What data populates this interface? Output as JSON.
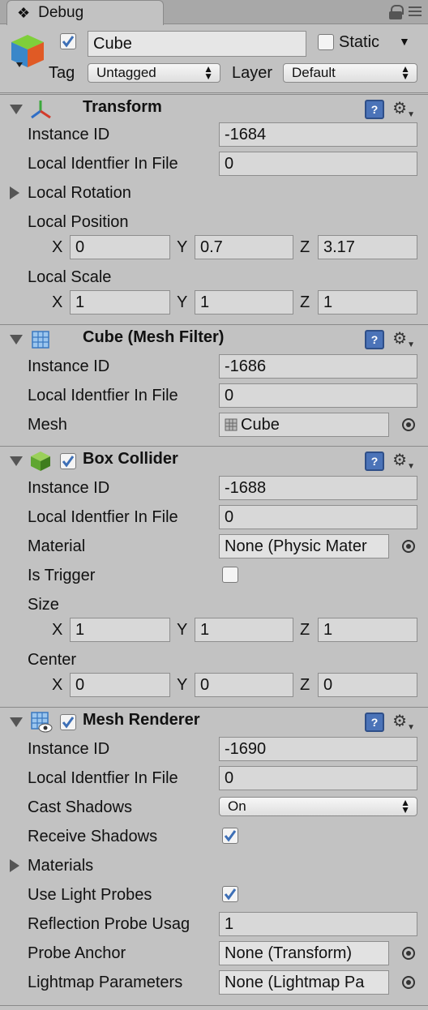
{
  "tab": {
    "title": "Debug"
  },
  "object": {
    "name": "Cube",
    "active": true,
    "static_label": "Static",
    "static_checked": false,
    "tag_label": "Tag",
    "tag_value": "Untagged",
    "layer_label": "Layer",
    "layer_value": "Default"
  },
  "transform": {
    "title": "Transform",
    "instance_id_label": "Instance ID",
    "instance_id": "-1684",
    "local_id_label": "Local Identfier In File",
    "local_id": "0",
    "rotation_label": "Local Rotation",
    "position_label": "Local Position",
    "position": {
      "x": "0",
      "y": "0.7",
      "z": "3.17"
    },
    "scale_label": "Local Scale",
    "scale": {
      "x": "1",
      "y": "1",
      "z": "1"
    }
  },
  "axis": {
    "x": "X",
    "y": "Y",
    "z": "Z"
  },
  "mesh_filter": {
    "title": "Cube (Mesh Filter)",
    "instance_id_label": "Instance ID",
    "instance_id": "-1686",
    "local_id_label": "Local Identfier In File",
    "local_id": "0",
    "mesh_label": "Mesh",
    "mesh_value": "Cube"
  },
  "box_collider": {
    "title": "Box Collider",
    "enabled": true,
    "instance_id_label": "Instance ID",
    "instance_id": "-1688",
    "local_id_label": "Local Identfier In File",
    "local_id": "0",
    "material_label": "Material",
    "material_value": "None (Physic Mater",
    "trigger_label": "Is Trigger",
    "trigger_checked": false,
    "size_label": "Size",
    "size": {
      "x": "1",
      "y": "1",
      "z": "1"
    },
    "center_label": "Center",
    "center": {
      "x": "0",
      "y": "0",
      "z": "0"
    }
  },
  "mesh_renderer": {
    "title": "Mesh Renderer",
    "enabled": true,
    "instance_id_label": "Instance ID",
    "instance_id": "-1690",
    "local_id_label": "Local Identfier In File",
    "local_id": "0",
    "cast_shadows_label": "Cast Shadows",
    "cast_shadows_value": "On",
    "receive_shadows_label": "Receive Shadows",
    "receive_shadows_checked": true,
    "materials_label": "Materials",
    "light_probes_label": "Use Light Probes",
    "light_probes_checked": true,
    "reflection_label": "Reflection Probe Usag",
    "reflection_value": "1",
    "probe_anchor_label": "Probe Anchor",
    "probe_anchor_value": "None (Transform)",
    "lightmap_label": "Lightmap Parameters",
    "lightmap_value": "None (Lightmap Pa"
  },
  "icons": {
    "tab": "info-circle",
    "lock": "lock",
    "menu": "list-menu",
    "help": "book-help",
    "gear": "gear",
    "picker": "object-picker"
  },
  "colors": {
    "panel": "#c2c2c2",
    "field": "#d8d8d8",
    "check": "#3d6fb6",
    "help": "#4b73b8"
  }
}
